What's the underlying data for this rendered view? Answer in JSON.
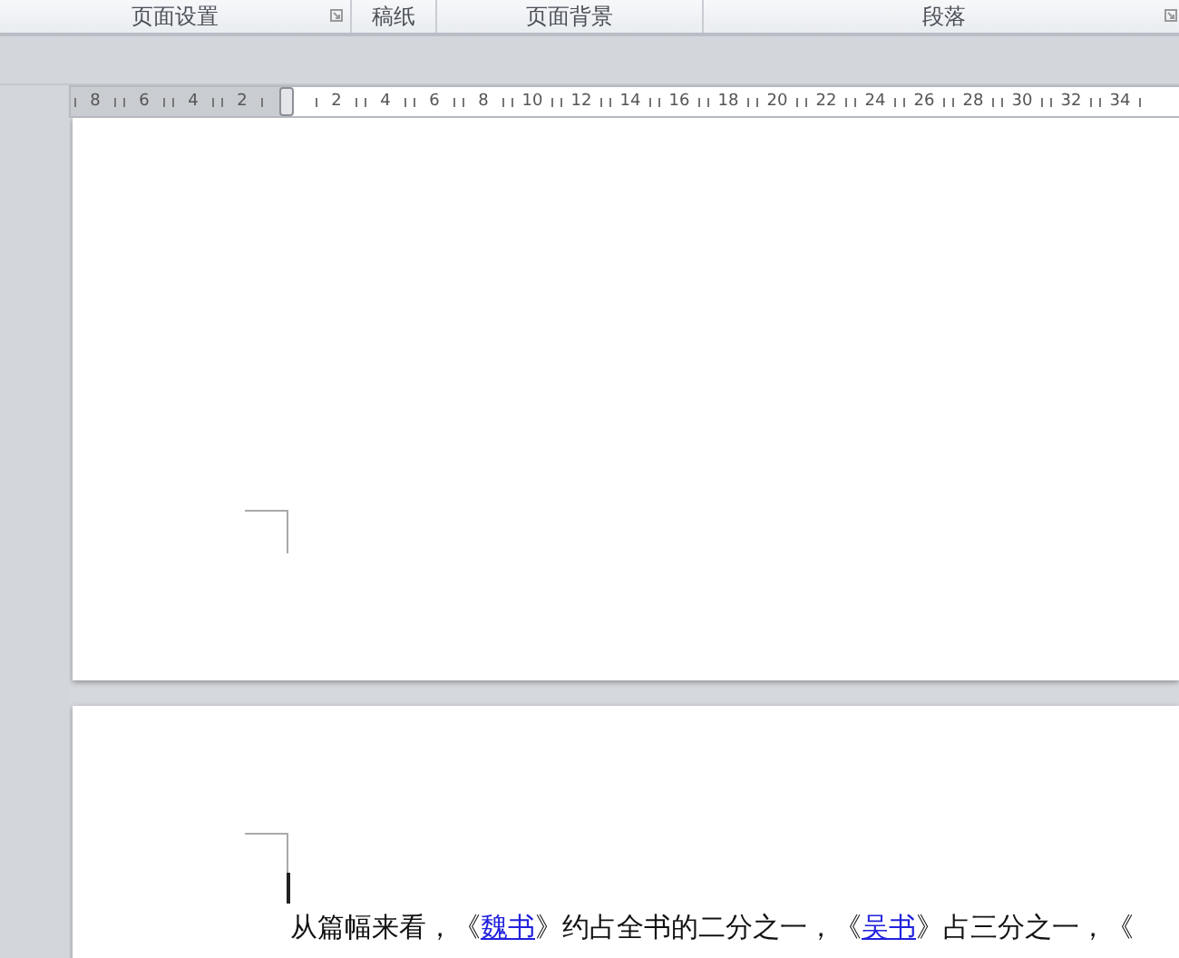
{
  "ribbon_groups": [
    {
      "label": "页面设置",
      "launcher": true
    },
    {
      "label": "稿纸",
      "launcher": false
    },
    {
      "label": "页面背景",
      "launcher": false
    },
    {
      "label": "段落",
      "launcher": true
    }
  ],
  "ruler": {
    "left_numbers": [
      "8",
      "6",
      "4",
      "2"
    ],
    "right_numbers": [
      "2",
      "4",
      "6",
      "8",
      "10",
      "12",
      "14",
      "16",
      "18",
      "20",
      "22",
      "24",
      "26",
      "28",
      "30",
      "32",
      "34"
    ]
  },
  "pages": [
    {
      "cursor": false
    },
    {
      "paragraph": [
        {
          "kind": "text",
          "text": "从篇幅来看，《"
        },
        {
          "kind": "link",
          "text": "魏书"
        },
        {
          "kind": "text",
          "text": "》约占全书的二分之一，《"
        },
        {
          "kind": "link",
          "text": "吴书"
        },
        {
          "kind": "text",
          "text": "》占三分之一，《"
        }
      ],
      "cursor": true
    }
  ]
}
